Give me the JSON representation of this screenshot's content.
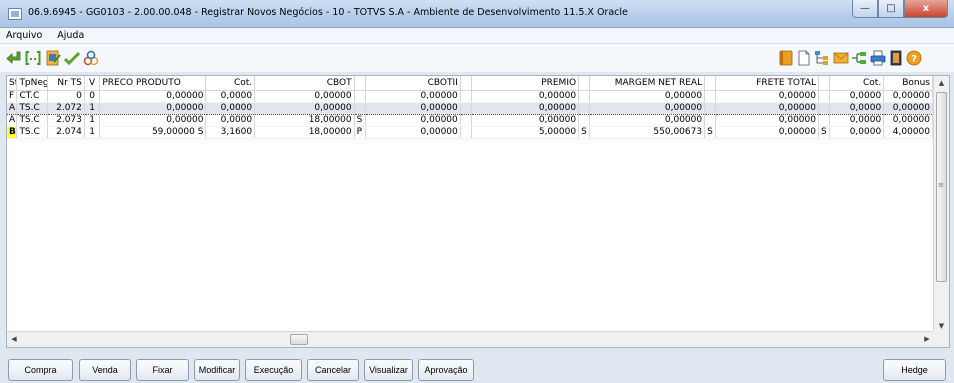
{
  "window": {
    "title": "06.9.6945 - GG0103 - 2.00.00.048 - Registrar Novos Negócios - 10 - TOTVS S.A - Ambiente de Desenvolvimento 11.5.X Oracle",
    "minimize": "—",
    "maximize": "□",
    "close": "x"
  },
  "menu": {
    "arquivo": "Arquivo",
    "ajuda": "Ajuda"
  },
  "toolbar_icons": [
    "exit-icon",
    "bracket-icon",
    "edit-document-icon",
    "check-icon",
    "molecule-icon",
    "book-icon",
    "new-page-icon",
    "tree-icon",
    "mail-icon",
    "network-icon",
    "print-icon",
    "door-icon",
    "help-icon"
  ],
  "grid": {
    "columns": [
      "St",
      "TpNeg",
      "Nr TS",
      "V",
      "PRECO PRODUTO",
      "Cot.",
      "CBOT",
      "CBOTII",
      "PREMIO",
      "MARGEM NET REAL",
      "FRETE TOTAL",
      "Cot.",
      "Bonus"
    ],
    "rows": [
      {
        "st": "F",
        "tpneg": "CT.C",
        "nrts": "0",
        "v": "0",
        "preco": "0,00000",
        "preco_f": "",
        "cot": "0,0000",
        "cbot": "0,00000",
        "cbot_f": "",
        "cbotii": "0,00000",
        "premio": "0,00000",
        "premio_f": "",
        "margem": "0,00000",
        "margem_f": "",
        "frete": "0,00000",
        "frete_f": "",
        "cot2": "0,0000",
        "bonus": "0,00000"
      },
      {
        "st": "A",
        "tpneg": "TS.C",
        "nrts": "2.072",
        "v": "1",
        "preco": "0,00000",
        "preco_f": "",
        "cot": "0,0000",
        "cbot": "0,00000",
        "cbot_f": "",
        "cbotii": "0,00000",
        "premio": "0,00000",
        "premio_f": "",
        "margem": "0,00000",
        "margem_f": "",
        "frete": "0,00000",
        "frete_f": "",
        "cot2": "0,0000",
        "bonus": "0,00000"
      },
      {
        "st": "A",
        "tpneg": "TS.C",
        "nrts": "2.073",
        "v": "1",
        "preco": "0,00000",
        "preco_f": "",
        "cot": "0,0000",
        "cbot": "18,00000",
        "cbot_f": "S",
        "cbotii": "0,00000",
        "premio": "0,00000",
        "premio_f": "",
        "margem": "0,00000",
        "margem_f": "",
        "frete": "0,00000",
        "frete_f": "",
        "cot2": "0,0000",
        "bonus": "0,00000"
      },
      {
        "st": "B",
        "tpneg": "TS.C",
        "nrts": "2.074",
        "v": "1",
        "preco": "59,00000",
        "preco_f": "S",
        "cot": "3,1600",
        "cbot": "18,00000",
        "cbot_f": "P",
        "cbotii": "0,00000",
        "premio": "5,00000",
        "premio_f": "S",
        "margem": "550,00673",
        "margem_f": "S",
        "frete": "0,00000",
        "frete_f": "S",
        "cot2": "0,0000",
        "bonus": "4,00000"
      }
    ],
    "selected_row": 1
  },
  "buttons": {
    "compra": "Compra",
    "venda": "Venda",
    "fixar": "Fixar",
    "modificar": "Modificar",
    "execucao": "Execução",
    "cancelar": "Cancelar",
    "visualizar": "Visualizar",
    "aprovacao": "Aprovação",
    "hedge": "Hedge"
  }
}
